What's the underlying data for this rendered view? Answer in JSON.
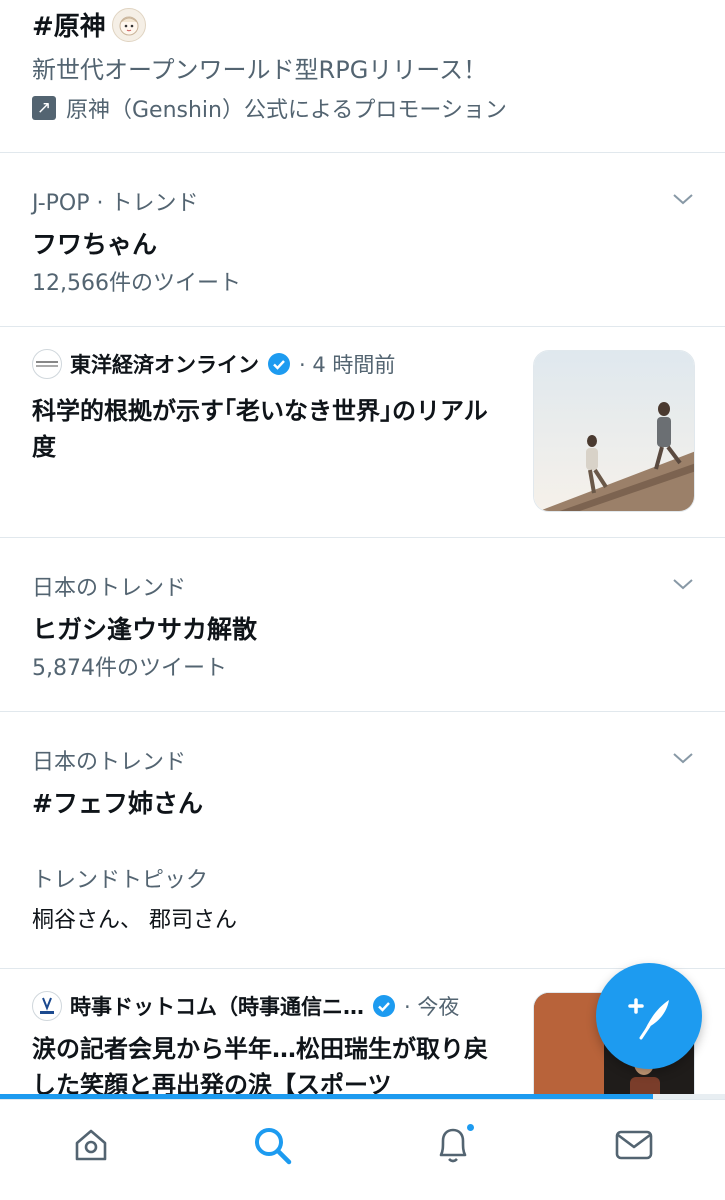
{
  "promo": {
    "title": "#原神",
    "description": "新世代オープンワールド型RPGリリース！",
    "promoted_by": "原神（Genshin）公式によるプロモーション"
  },
  "trends": [
    {
      "meta": "J-POP · トレンド",
      "name": "フワちゃん",
      "count": "12,566件のツイート"
    },
    {
      "meta": "日本のトレンド",
      "name": "ヒガシ逢ウサカ解散",
      "count": "5,874件のツイート"
    },
    {
      "meta": "日本のトレンド",
      "name": "#フェフ姉さん",
      "topic_label": "トレンドトピック",
      "topic_items": "桐谷さん、 郡司さん"
    }
  ],
  "news": [
    {
      "source": "東洋経済オンライン",
      "time": "· 4 時間前",
      "headline": "科学的根拠が示す｢老いなき世界｣のリアル度"
    },
    {
      "source": "時事ドットコム（時事通信ニ…",
      "time": "· 今夜",
      "headline": "涙の記者会見から半年…松田瑞生が取り戻した笑顔と再出発の涙【スポーツ"
    }
  ],
  "tabs": [
    "home-icon",
    "search-icon",
    "notifications-icon",
    "messages-icon"
  ],
  "progress": 0.9,
  "colors": {
    "accent": "#1d9bf0",
    "muted": "#536471",
    "text": "#0f1419",
    "divider": "#e1e8ed"
  }
}
